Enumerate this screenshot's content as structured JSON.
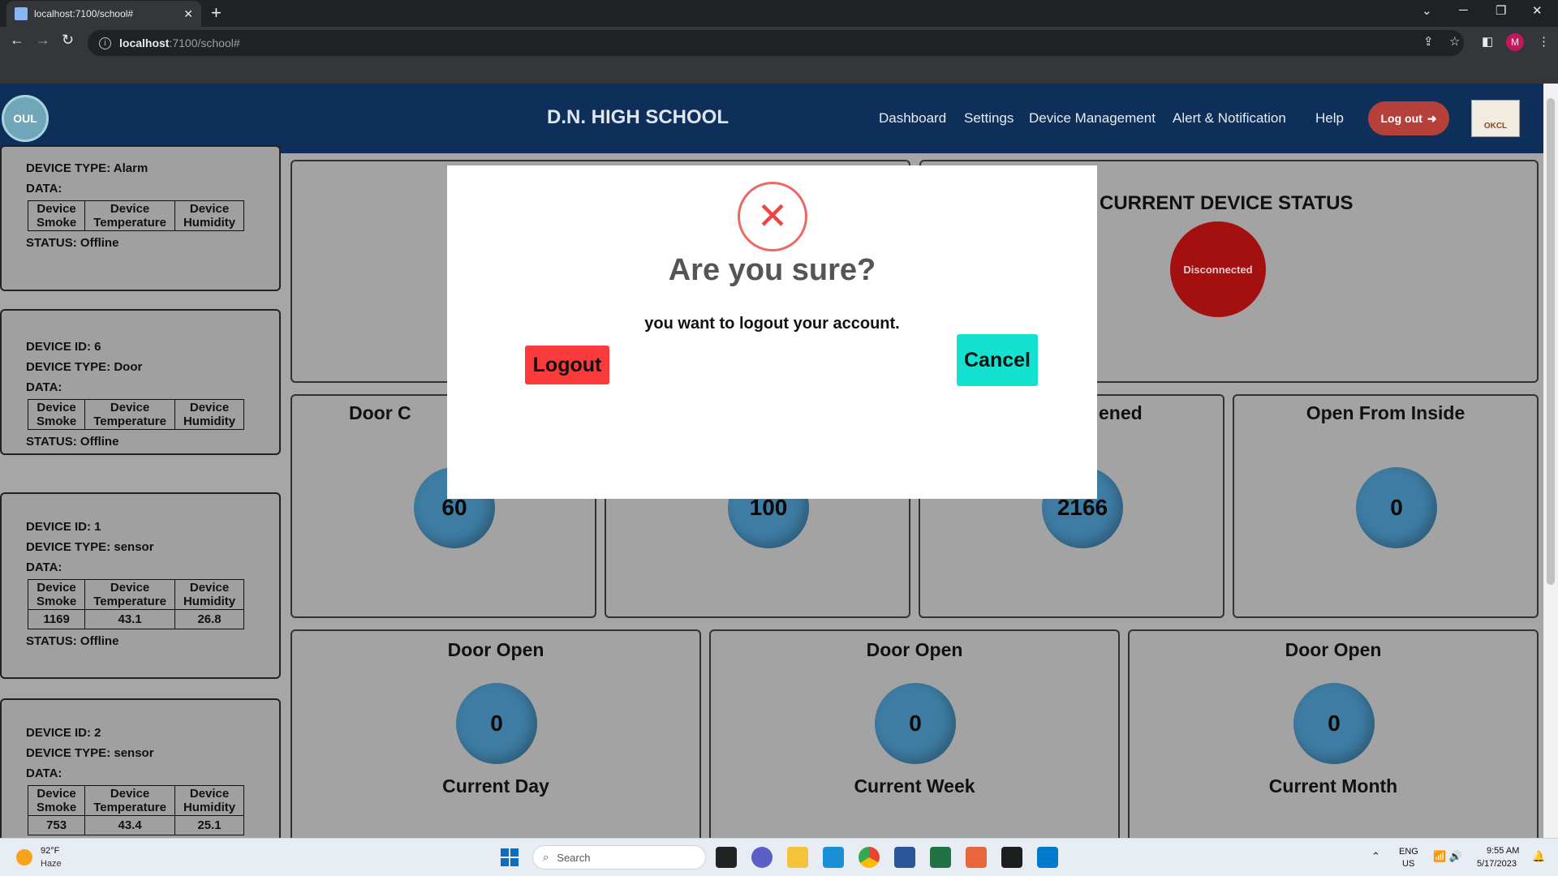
{
  "browser": {
    "tab_title": "localhost:7100/school#",
    "url_host": "localhost",
    "url_rest": ":7100/school#",
    "new_tab": "+",
    "tab_close": "✕"
  },
  "header": {
    "logo_text": "OUL",
    "school_name": "D.N. HIGH SCHOOL",
    "nav": [
      "Dashboard",
      "Settings",
      "Device Management",
      "Alert & Notification",
      "Help"
    ],
    "logout_label": "Log out",
    "partner_logo_text": "OKCL"
  },
  "sidebar": {
    "table_headers": [
      [
        "Device",
        "Smoke"
      ],
      [
        "Device",
        "Temperature"
      ],
      [
        "Device",
        "Humidity"
      ]
    ],
    "cards": [
      {
        "id_line": "",
        "type_line": "DEVICE TYPE: Alarm",
        "data_label": "DATA:",
        "status_line": "STATUS: Offline",
        "values": []
      },
      {
        "id_line": "DEVICE ID: 6",
        "type_line": "DEVICE TYPE: Door",
        "data_label": "DATA:",
        "status_line": "STATUS: Offline",
        "values": []
      },
      {
        "id_line": "DEVICE ID: 1",
        "type_line": "DEVICE TYPE: sensor",
        "data_label": "DATA:",
        "status_line": "STATUS:  Offline",
        "values": [
          "1169",
          "43.1",
          "26.8"
        ]
      },
      {
        "id_line": "DEVICE ID: 2",
        "type_line": "DEVICE TYPE: sensor",
        "data_label": "DATA:",
        "status_line": "",
        "values": [
          "753",
          "43.4",
          "25.1"
        ]
      }
    ]
  },
  "tiles": {
    "status_title": "CURRENT DEVICE STATUS",
    "status_value": "Disconnected",
    "row1": [
      {
        "title": "Door C",
        "value": "60"
      },
      {
        "title": "",
        "value": "100"
      },
      {
        "title": "ened",
        "value": "2166"
      },
      {
        "title": "Open From Inside",
        "value": "0"
      }
    ],
    "row2": [
      {
        "title": "Door Open",
        "value": "0",
        "sub": "Current Day"
      },
      {
        "title": "Door Open",
        "value": "0",
        "sub": "Current Week"
      },
      {
        "title": "Door Open",
        "value": "0",
        "sub": "Current Month"
      }
    ]
  },
  "modal": {
    "icon": "✕",
    "title": "Are you sure?",
    "text": "you want to logout your account.",
    "confirm_label": "Logout",
    "cancel_label": "Cancel"
  },
  "taskbar": {
    "temp": "92°F",
    "weather": "Haze",
    "search_placeholder": "Search",
    "lang1": "ENG",
    "lang2": "US",
    "time": "9:55 AM",
    "date": "5/17/2023"
  }
}
